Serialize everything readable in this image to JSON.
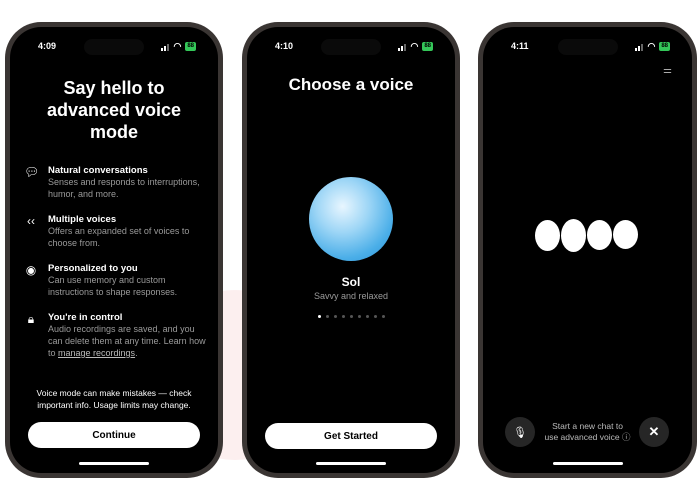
{
  "screens": [
    {
      "time": "4:09",
      "battery": "88",
      "title_lines": [
        "Say hello to",
        "advanced voice",
        "mode"
      ],
      "features": [
        {
          "icon": "chat-bubbles-icon",
          "title": "Natural conversations",
          "desc": "Senses and responds to interruptions, humor, and more."
        },
        {
          "icon": "voices-icon",
          "title": "Multiple voices",
          "desc": "Offers an expanded set of voices to choose from."
        },
        {
          "icon": "person-circle-icon",
          "title": "Personalized to you",
          "desc": "Can use memory and custom instructions to shape responses."
        },
        {
          "icon": "lock-icon",
          "title": "You're in control",
          "desc": "Audio recordings are saved, and you can delete them at any time. Learn how to ",
          "link": "manage recordings",
          "desc_end": "."
        }
      ],
      "note": "Voice mode can make mistakes — check important info. Usage limits may change.",
      "button": "Continue"
    },
    {
      "time": "4:10",
      "battery": "88",
      "title": "Choose a voice",
      "voice_name": "Sol",
      "voice_desc": "Savvy and relaxed",
      "page_dots": 9,
      "active_dot": 1,
      "button": "Get Started"
    },
    {
      "time": "4:11",
      "battery": "88",
      "hint_lines": [
        "Start a new chat to",
        "use advanced voice"
      ],
      "icons": [
        "settings-sliders-icon",
        "microphone-icon",
        "close-icon",
        "info-icon"
      ]
    }
  ],
  "colors": {
    "battery": "#34c759",
    "orb": "#5ab8ee"
  }
}
